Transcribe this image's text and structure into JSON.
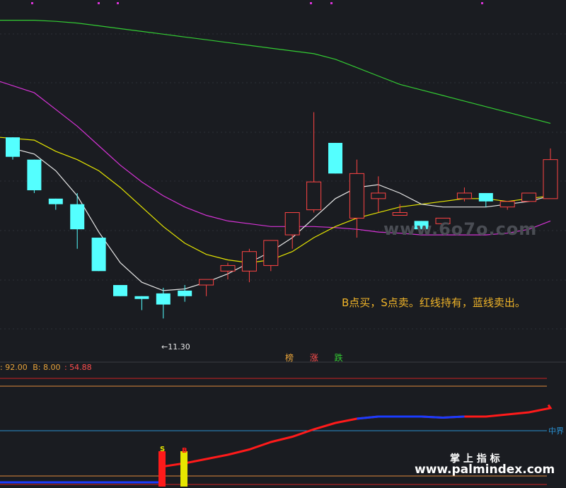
{
  "top_panel": {
    "low_marker": "←11.30",
    "note": "B点买，S点卖。红线持有，蓝线卖出。",
    "watermark": "www.6o7o.com",
    "tabs": [
      {
        "label": "榜",
        "color": "#e8a33a"
      },
      {
        "label": "涨",
        "color": "#ff4d4d"
      },
      {
        "label": "跌",
        "color": "#33cc33"
      }
    ]
  },
  "indicator_panel": {
    "header": [
      {
        "text": ": 92.00",
        "color": "#e8a33a"
      },
      {
        "text": "B: 8.00",
        "color": "#e8a33a"
      },
      {
        "text": ": 54.88",
        "color": "#ff4d4d"
      }
    ],
    "mid_label": "中界",
    "s_label": "S",
    "b_label": "B",
    "brand": "掌 上 指 标",
    "url": "www.palmindex.com"
  },
  "colors": {
    "background": "#1a1c21",
    "up_candle": "#ff4444",
    "down_candle": "#54ffff",
    "ma_white": "#e8e8e8",
    "ma_yellow": "#e6e600",
    "ma_magenta": "#d633d6",
    "ma_green": "#33cc33",
    "hold_line": "#ff1a1a",
    "sell_line": "#1a3cff"
  },
  "chart_data": {
    "type": "candlestick",
    "candles": [
      {
        "open": 14.2,
        "high": 14.2,
        "low": 13.8,
        "close": 13.85
      },
      {
        "open": 13.8,
        "high": 13.8,
        "low": 13.2,
        "close": 13.25
      },
      {
        "open": 13.1,
        "high": 13.1,
        "low": 12.9,
        "close": 13.0
      },
      {
        "open": 13.0,
        "high": 13.2,
        "low": 12.2,
        "close": 12.55
      },
      {
        "open": 12.4,
        "high": 12.4,
        "low": 11.8,
        "close": 11.8
      },
      {
        "open": 11.55,
        "high": 11.55,
        "low": 11.35,
        "close": 11.35
      },
      {
        "open": 11.35,
        "high": 11.35,
        "low": 11.1,
        "close": 11.3
      },
      {
        "open": 11.4,
        "high": 11.5,
        "low": 10.95,
        "close": 11.2
      },
      {
        "open": 11.45,
        "high": 11.55,
        "low": 11.25,
        "close": 11.35
      },
      {
        "open": 11.55,
        "high": 11.65,
        "low": 11.35,
        "close": 11.65
      },
      {
        "open": 11.8,
        "high": 11.95,
        "low": 11.65,
        "close": 11.9
      },
      {
        "open": 11.8,
        "high": 12.2,
        "low": 11.6,
        "close": 12.15
      },
      {
        "open": 11.9,
        "high": 12.35,
        "low": 11.8,
        "close": 12.35
      },
      {
        "open": 12.45,
        "high": 12.85,
        "low": 12.2,
        "close": 12.85
      },
      {
        "open": 12.9,
        "high": 14.65,
        "low": 12.85,
        "close": 13.4
      },
      {
        "open": 14.1,
        "high": 14.1,
        "low": 13.55,
        "close": 13.55
      },
      {
        "open": 12.75,
        "high": 13.8,
        "low": 12.4,
        "close": 13.55
      },
      {
        "open": 13.1,
        "high": 13.5,
        "low": 12.85,
        "close": 13.2
      },
      {
        "open": 12.8,
        "high": 13.0,
        "low": 12.8,
        "close": 12.85
      },
      {
        "open": 12.7,
        "high": 12.7,
        "low": 12.55,
        "close": 12.55
      },
      {
        "open": 12.65,
        "high": 12.75,
        "low": 12.6,
        "close": 12.75
      },
      {
        "open": 13.1,
        "high": 13.3,
        "low": 13.05,
        "close": 13.2
      },
      {
        "open": 13.2,
        "high": 13.2,
        "low": 12.95,
        "close": 13.05
      },
      {
        "open": 12.95,
        "high": 13.05,
        "low": 12.9,
        "close": 13.05
      },
      {
        "open": 13.05,
        "high": 13.2,
        "low": 13.05,
        "close": 13.2
      },
      {
        "open": 13.1,
        "high": 14.0,
        "low": 13.1,
        "close": 13.8
      }
    ],
    "ma_white": [
      14.0,
      13.9,
      13.6,
      13.15,
      12.5,
      11.95,
      11.6,
      11.45,
      11.48,
      11.6,
      11.75,
      11.95,
      12.15,
      12.4,
      12.75,
      13.1,
      13.3,
      13.35,
      13.2,
      13.0,
      12.95,
      12.95,
      12.95,
      13.0,
      13.05,
      13.15
    ],
    "ma_yellow": [
      14.2,
      14.15,
      13.95,
      13.8,
      13.6,
      13.3,
      12.95,
      12.6,
      12.3,
      12.1,
      12.0,
      11.95,
      12.0,
      12.15,
      12.4,
      12.6,
      12.75,
      12.85,
      12.95,
      13.0,
      13.05,
      13.1,
      13.1,
      13.05,
      13.1,
      13.15
    ],
    "ma_magenta": [
      15.2,
      15.0,
      14.7,
      14.4,
      14.05,
      13.7,
      13.4,
      13.15,
      12.95,
      12.8,
      12.7,
      12.65,
      12.6,
      12.6,
      12.6,
      12.58,
      12.55,
      12.5,
      12.48,
      12.45,
      12.45,
      12.45,
      12.45,
      12.48,
      12.55,
      12.7
    ],
    "ma_green": [
      16.3,
      16.3,
      16.28,
      16.25,
      16.2,
      16.15,
      16.1,
      16.05,
      16.0,
      15.95,
      15.9,
      15.85,
      15.8,
      15.75,
      15.7,
      15.6,
      15.45,
      15.3,
      15.15,
      15.05,
      14.95,
      14.85,
      14.75,
      14.65,
      14.55,
      14.45
    ],
    "y_range": [
      10.7,
      16.6
    ],
    "indicator": {
      "hold_line": [
        7,
        7,
        8,
        9,
        10,
        12,
        14,
        17,
        20,
        24,
        28,
        33,
        40,
        45,
        52,
        58,
        62,
        64,
        64,
        64,
        63,
        64,
        64,
        66,
        68,
        72
      ],
      "b_value": 8.0,
      "s_value": 92.0,
      "mid_value": 54.88
    }
  }
}
